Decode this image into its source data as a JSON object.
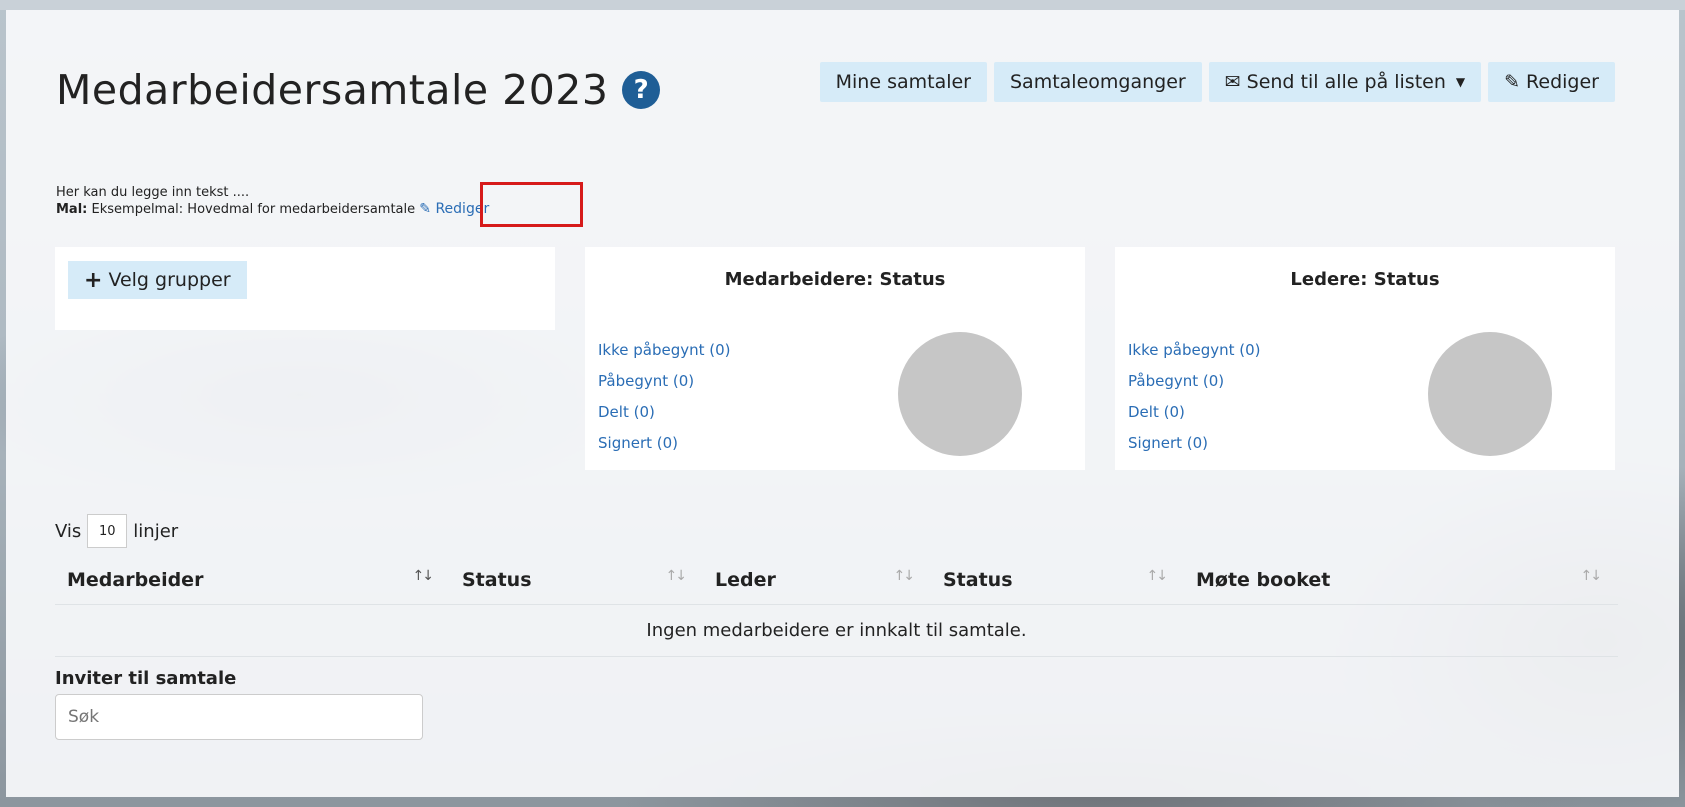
{
  "page": {
    "title": "Medarbeidersamtale 2023",
    "help_icon": "question-circle-icon"
  },
  "toolbar": {
    "my_conversations": "Mine samtaler",
    "rounds": "Samtaleomganger",
    "send_all": "Send til alle på listen",
    "edit": "Rediger"
  },
  "intro": {
    "text": "Her kan du legge inn tekst ....",
    "template_label": "Mal:",
    "template_value": "Eksempelmal: Hovedmal for medarbeidersamtale",
    "edit_link": "Rediger"
  },
  "groups": {
    "button": "Velg grupper"
  },
  "employees_status": {
    "title": "Medarbeidere: Status",
    "items": [
      "Ikke påbegynt (0)",
      "Påbegynt (0)",
      "Delt (0)",
      "Signert (0)"
    ]
  },
  "leaders_status": {
    "title": "Ledere: Status",
    "items": [
      "Ikke påbegynt (0)",
      "Påbegynt (0)",
      "Delt (0)",
      "Signert (0)"
    ]
  },
  "table": {
    "show_prefix": "Vis",
    "show_value": "10",
    "show_suffix": "linjer",
    "columns": [
      "Medarbeider",
      "Status",
      "Leder",
      "Status",
      "Møte booket"
    ],
    "empty_message": "Ingen medarbeidere er innkalt til samtale."
  },
  "invite": {
    "label": "Inviter til samtale",
    "search_placeholder": "Søk"
  },
  "colors": {
    "button_bg": "#d6ebf8",
    "link": "#2a6db5",
    "help_icon": "#1f5e96",
    "pie_empty": "#c6c6c6",
    "highlight": "#d61a1a"
  }
}
